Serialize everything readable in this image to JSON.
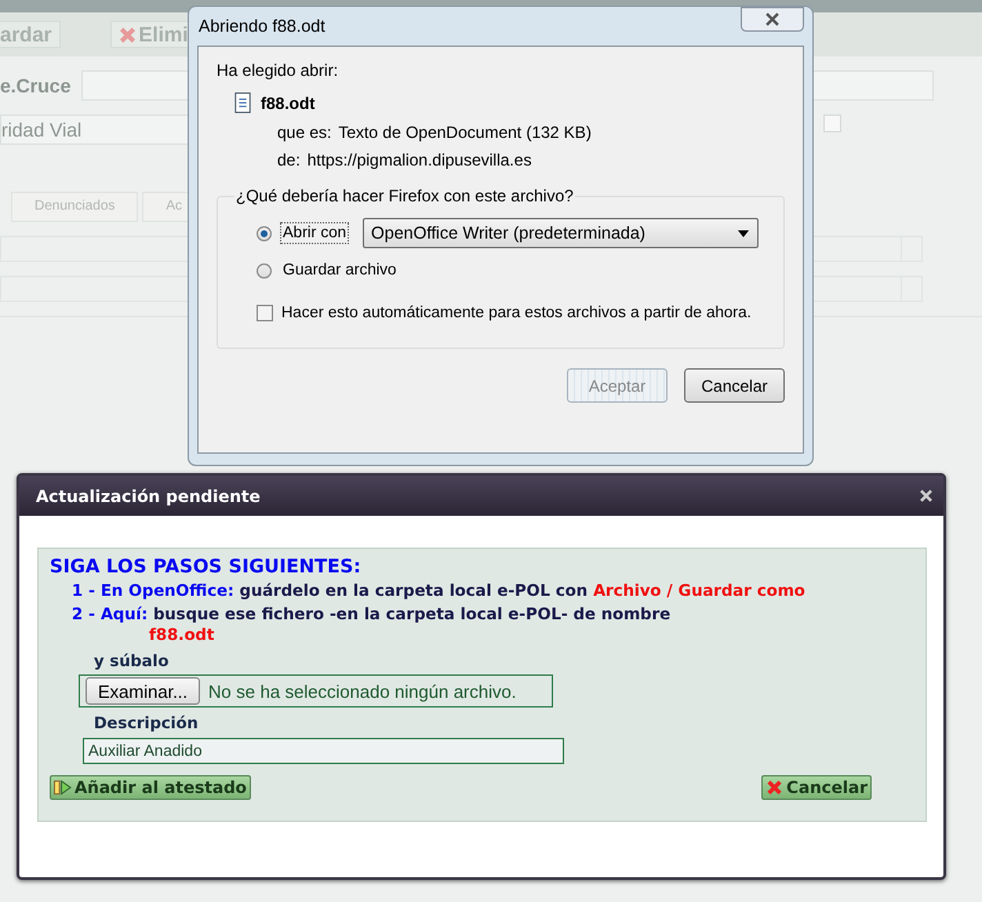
{
  "background_page": {
    "toolbar_buttons": [
      {
        "label": "ardar",
        "kind": "plain"
      },
      {
        "label": "Elimi",
        "kind": "delete"
      }
    ],
    "cross_field": {
      "label": "e.Cruce"
    },
    "road_field": {
      "value": "ridad Vial"
    },
    "flag_checkbox": {
      "checked": false
    },
    "tabs": [
      {
        "label": "Denunciados"
      },
      {
        "label": "Ac"
      }
    ]
  },
  "open_dialog": {
    "title": "Abriendo f88.odt",
    "intro": "Ha elegido abrir:",
    "file_name": "f88.odt",
    "details": [
      {
        "label": "que es:",
        "value": "Texto de OpenDocument (132 KB)"
      },
      {
        "label": "de:",
        "value": "https://pigmalion.dipusevilla.es"
      }
    ],
    "group_title": "¿Qué debería hacer Firefox con este archivo?",
    "options": [
      {
        "label": "Abrir con",
        "selected": true
      },
      {
        "label": "Guardar archivo",
        "selected": false
      }
    ],
    "app_select": "OpenOffice Writer (predeterminada)",
    "remember": {
      "label": "Hacer esto automáticamente para estos archivos a partir de ahora.",
      "checked": false
    },
    "buttons": [
      {
        "label": "Aceptar",
        "disabled": true
      },
      {
        "label": "Cancelar",
        "disabled": false
      }
    ]
  },
  "update_dialog": {
    "title": "Actualización pendiente",
    "heading": "SIGA LOS PASOS SIGUIENTES:",
    "steps": [
      {
        "lead": "1 - En OpenOffice:",
        "text": "guárdelo en la carpeta local e-POL con",
        "highlight": "Archivo / Guardar como",
        "highlight_on_new_line": false
      },
      {
        "lead": "2 - Aquí:",
        "text": "busque ese fichero -en la carpeta local e-POL- de nombre",
        "highlight": "f88.odt",
        "highlight_on_new_line": true
      }
    ],
    "upload_label": "y súbalo",
    "browse_button": "Examinar...",
    "file_status": "No se ha seleccionado ningún archivo.",
    "description_label": "Descripción",
    "description_value": "Auxiliar Anadido",
    "buttons": [
      {
        "label": "Añadir al atestado",
        "kind": "add"
      },
      {
        "label": "Cancelar",
        "kind": "cancel"
      }
    ]
  }
}
